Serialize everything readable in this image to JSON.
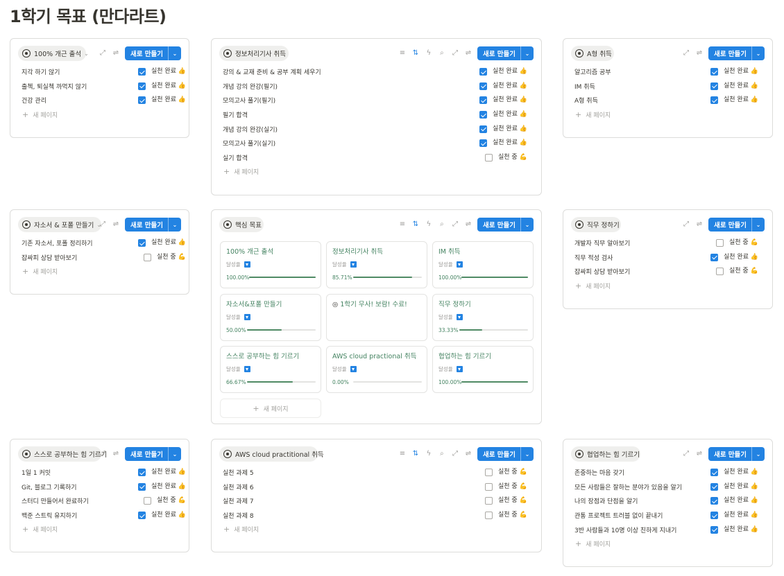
{
  "page_title": "1학기 목표 (만다라트)",
  "accent_color": "#2383e2",
  "progress_color": "#4f8a64",
  "status_labels": {
    "done": "실천 완료 👍",
    "doing": "실천 중 💪"
  },
  "new_button_label": "새로 만들기",
  "new_page_label": "새 페이지",
  "progress_label": "달성율",
  "cards": [
    {
      "title": "100% 개근 출석",
      "tools": "short",
      "dropdown": true,
      "rows": [
        {
          "name": "지각 하기 않기",
          "checked": true,
          "status": "실천 완료 👍"
        },
        {
          "name": "출첵, 퇴실첵 까먹지 않기",
          "checked": true,
          "status": "실천 완료 👍"
        },
        {
          "name": "건강 관리",
          "checked": true,
          "status": "실천 완료 👍"
        }
      ]
    },
    {
      "title": "정보처리기사 취득",
      "tools": "full",
      "rows": [
        {
          "name": "강의 & 교재 준비 & 공부 계획 세우기",
          "checked": true,
          "status": "실천 완료 👍"
        },
        {
          "name": "개념 강의 완강(필기)",
          "checked": true,
          "status": "실천 완료 👍"
        },
        {
          "name": "모의고사 풀기(필기)",
          "checked": true,
          "status": "실천 완료 👍"
        },
        {
          "name": "필기 합격",
          "checked": true,
          "status": "실천 완료 👍"
        },
        {
          "name": "개념 강의 완강(실기)",
          "checked": true,
          "status": "실천 완료 👍"
        },
        {
          "name": "모의고사 풀기(실기)",
          "checked": true,
          "status": "실천 완료 👍"
        },
        {
          "name": "실기 합격",
          "checked": false,
          "status": "실천 중 💪"
        }
      ]
    },
    {
      "title": "A형 취득",
      "tools": "short",
      "rows": [
        {
          "name": "알고리즘 공부",
          "checked": true,
          "status": "실천 완료 👍"
        },
        {
          "name": "IM 취득",
          "checked": true,
          "status": "실천 완료 👍"
        },
        {
          "name": "A형 취득",
          "checked": true,
          "status": "실천 완료 👍"
        }
      ]
    },
    {
      "title": "자소서 & 포폴 만들기",
      "tools": "short",
      "dropdown": true,
      "rows": [
        {
          "name": "기존 자소서, 포폴 정리하기",
          "checked": true,
          "status": "실천 완료 👍"
        },
        {
          "name": "잡싸피 상담 받아보기",
          "checked": false,
          "status": "실천 중 💪"
        }
      ]
    },
    {
      "title": "핵심 목표",
      "tools": "full",
      "gallery": true,
      "gallery_items": [
        {
          "title": "100% 개근 출석",
          "progress": 100.0,
          "progress_text": "100.00%"
        },
        {
          "title": "정보처리기사 취득",
          "progress": 85.71,
          "progress_text": "85.71%"
        },
        {
          "title": "IM 취득",
          "progress": 100.0,
          "progress_text": "100.00%"
        },
        {
          "title": "자소서&포폴 만들기",
          "progress": 50.0,
          "progress_text": "50.00%"
        },
        {
          "title": "1학기 무사! 보람! 수료!",
          "center": true
        },
        {
          "title": "직무 정하기",
          "progress": 33.33,
          "progress_text": "33.33%"
        },
        {
          "title": "스스로 공부하는 힘 기르기",
          "progress": 66.67,
          "progress_text": "66.67%"
        },
        {
          "title": "AWS cloud practional 취득",
          "progress": 0.0,
          "progress_text": "0.00%"
        },
        {
          "title": "협업하는 힘 기르기",
          "progress": 100.0,
          "progress_text": "100.00%"
        }
      ]
    },
    {
      "title": "직무 정하기",
      "tools": "short",
      "rows": [
        {
          "name": "개발자 직무 알아보기",
          "checked": false,
          "status": "실천 중 💪"
        },
        {
          "name": "직무 적성 검사",
          "checked": true,
          "status": "실천 완료 👍"
        },
        {
          "name": "잡싸피 상담 받아보기",
          "checked": false,
          "status": "실천 중 💪"
        }
      ]
    },
    {
      "title": "스스로 공부하는 힘 기르기",
      "tools": "short",
      "rows": [
        {
          "name": "1일 1 커밋",
          "checked": true,
          "status": "실천 완료 👍"
        },
        {
          "name": "Git, 블로그 기록하기",
          "checked": true,
          "status": "실천 완료 👍"
        },
        {
          "name": "스터디 만들어서 완료하기",
          "checked": false,
          "status": "실천 중 💪"
        },
        {
          "name": "백준 스트릭 유지하기",
          "checked": true,
          "status": "실천 완료 👍"
        }
      ]
    },
    {
      "title": "AWS cloud practitional 취득",
      "tools": "full",
      "rows": [
        {
          "name": "실천 과제 5",
          "checked": false,
          "status": "실천 중 💪"
        },
        {
          "name": "실천 과제 6",
          "checked": false,
          "status": "실천 중 💪"
        },
        {
          "name": "실천 과제 7",
          "checked": false,
          "status": "실천 중 💪"
        },
        {
          "name": "실천 과제 8",
          "checked": false,
          "status": "실천 중 💪"
        }
      ]
    },
    {
      "title": "협업하는 힘 기르기",
      "tools": "short",
      "rows": [
        {
          "name": "존중하는 마음 갖기",
          "checked": true,
          "status": "실천 완료 👍"
        },
        {
          "name": "모든 사람들은 잘하는 분야가 있음을 알기",
          "checked": true,
          "status": "실천 완료 👍"
        },
        {
          "name": "나의 장점과 단점을 알기",
          "checked": true,
          "status": "실천 완료 👍"
        },
        {
          "name": "관통 프로젝트 트러블 없이 끝내기",
          "checked": true,
          "status": "실천 완료 👍"
        },
        {
          "name": "3반 사람들과 10명 이상 친하게 지내기",
          "checked": true,
          "status": "실천 완료 👍"
        }
      ]
    }
  ]
}
